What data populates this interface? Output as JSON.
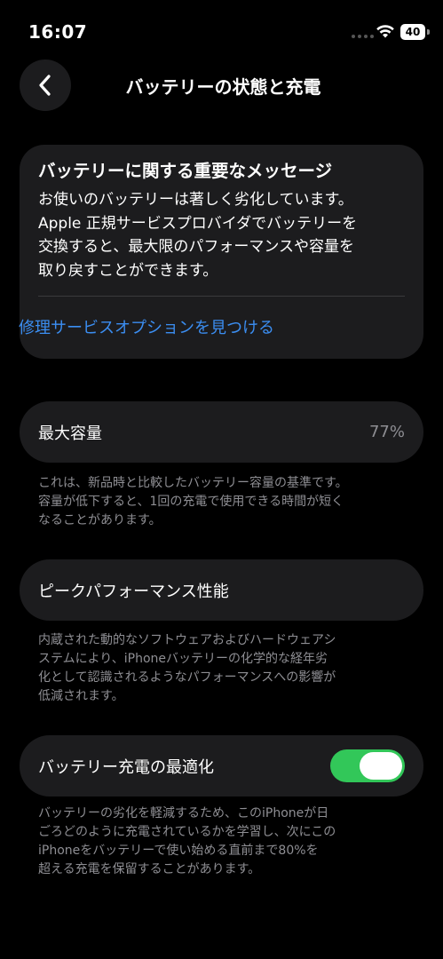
{
  "status_bar": {
    "time": "16:07",
    "battery_level": "40"
  },
  "header": {
    "title": "バッテリーの状態と充電"
  },
  "message": {
    "title": "バッテリーに関する重要なメッセージ",
    "body": "お使いのバッテリーは著しく劣化しています。\nApple 正規サービスプロバイダでバッテリーを\n交換すると、最大限のパフォーマンスや容量を\n取り戻すことができます。",
    "link": "修理サービスオプションを見つける"
  },
  "max_capacity": {
    "label": "最大容量",
    "value": "77%",
    "footnote": "これは、新品時と比較したバッテリー容量の基準です。\n容量が低下すると、1回の充電で使用できる時間が短く\nなることがあります。"
  },
  "peak_performance": {
    "label": "ピークパフォーマンス性能",
    "footnote": "内蔵された動的なソフトウェアおよびハードウェアシ\nステムにより、iPhoneバッテリーの化学的な経年劣\n化として認識されるようなパフォーマンスへの影響が\n低減されます。"
  },
  "optimized_charging": {
    "label": "バッテリー充電の最適化",
    "enabled": true,
    "footnote": "バッテリーの劣化を軽減するため、このiPhoneが日\nごろどのように充電されているかを学習し、次にこの\niPhoneをバッテリーで使い始める直前まで80%を\n超える充電を保留することがあります。"
  },
  "colors": {
    "background": "#000000",
    "card": "#1c1c1e",
    "link": "#3b8ef2",
    "toggle_on": "#32c759",
    "secondary_text": "#8e8e93"
  }
}
